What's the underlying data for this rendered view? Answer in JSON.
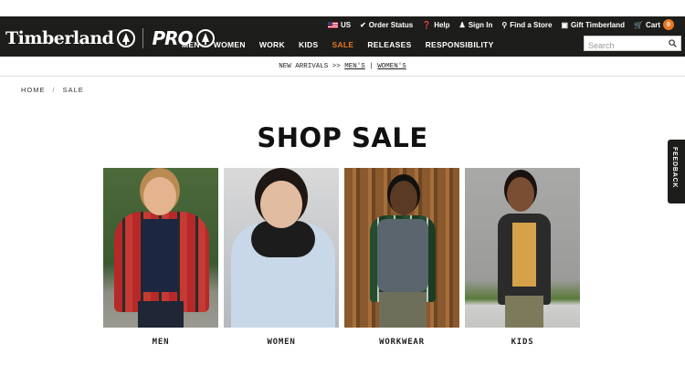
{
  "header": {
    "logo_text": "Timberland",
    "pro_text": "PRO",
    "utility": {
      "country": "US",
      "order_status": "Order Status",
      "help": "Help",
      "sign_in": "Sign In",
      "find_store": "Find a Store",
      "gift": "Gift Timberland",
      "cart": "Cart",
      "cart_count": "0"
    },
    "nav": [
      "MEN",
      "WOMEN",
      "WORK",
      "KIDS",
      "SALE",
      "RELEASES",
      "RESPONSIBILITY"
    ],
    "search_placeholder": "Search"
  },
  "promo": {
    "prefix": "NEW ARRIVALS >>",
    "mens": "MEN'S",
    "separator": "|",
    "womens": "WOMEN'S"
  },
  "breadcrumb": {
    "home": "HOME",
    "separator": "/",
    "current": "SALE"
  },
  "page_title": "SHOP SALE",
  "feedback_label": "FEEDBACK",
  "tiles": [
    {
      "label": "MEN"
    },
    {
      "label": "WOMEN"
    },
    {
      "label": "WORKWEAR"
    },
    {
      "label": "KIDS"
    }
  ],
  "colors": {
    "header_bg": "#1d1d1b",
    "accent_sale": "#e87722",
    "text": "#222222"
  }
}
